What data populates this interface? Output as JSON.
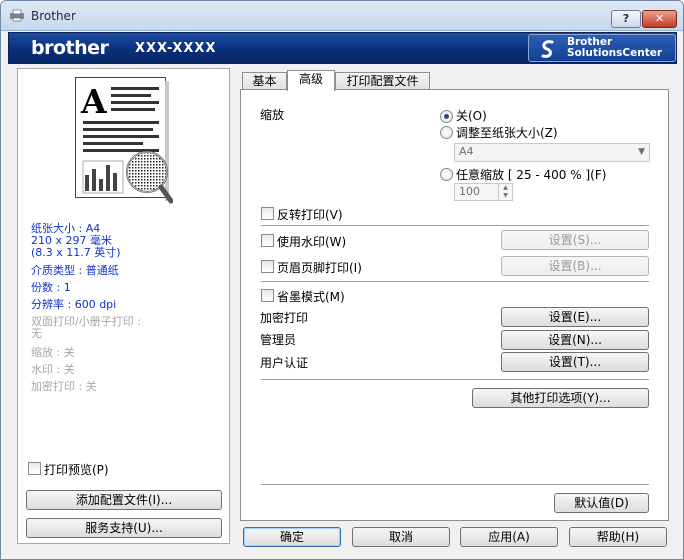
{
  "window": {
    "title": "Brother",
    "help_btn": "?",
    "close_btn": "✕"
  },
  "brand": {
    "logo": "brother",
    "model": "XXX-XXXX",
    "solutions_line1": "Brother",
    "solutions_line2": "SolutionsCenter"
  },
  "left": {
    "paper_size_line1": "纸张大小 : A4",
    "paper_size_line2": "210 x 297 毫米",
    "paper_size_line3": "(8.3 x 11.7 英寸)",
    "media": "介质类型 : 普通纸",
    "copies": "份数 : 1",
    "resolution": "分辨率 : 600 dpi",
    "duplex": "双面打印/小册子打印 :",
    "duplex_val": "无",
    "scaling": "缩放 : 关",
    "watermark": "水印 : 关",
    "secure": "加密打印 : 关",
    "print_preview": "打印预览(P)",
    "add_profile": "添加配置文件(I)...",
    "support": "服务支持(U)..."
  },
  "tabs": [
    "基本",
    "高级",
    "打印配置文件"
  ],
  "panel": {
    "scaling_label": "缩放",
    "opt_off": "关(O)",
    "opt_fit": "调整至纸张大小(Z)",
    "fit_combo": "A4",
    "opt_free": "任意缩放 [ 25 - 400 % ](F)",
    "free_value": "100",
    "reverse": "反转打印(V)",
    "use_watermark": "使用水印(W)",
    "header_footer": "页眉页脚打印(I)",
    "settings_s": "设置(S)...",
    "settings_b": "设置(B)...",
    "toner_save": "省墨模式(M)",
    "secure_print": "加密打印",
    "admin": "管理员",
    "user_auth": "用户认证",
    "settings_e": "设置(E)...",
    "settings_n": "设置(N)...",
    "settings_t": "设置(T)...",
    "other_options": "其他打印选项(Y)...",
    "defaults": "默认值(D)"
  },
  "footer": {
    "ok": "确定",
    "cancel": "取消",
    "apply": "应用(A)",
    "help": "帮助(H)"
  }
}
